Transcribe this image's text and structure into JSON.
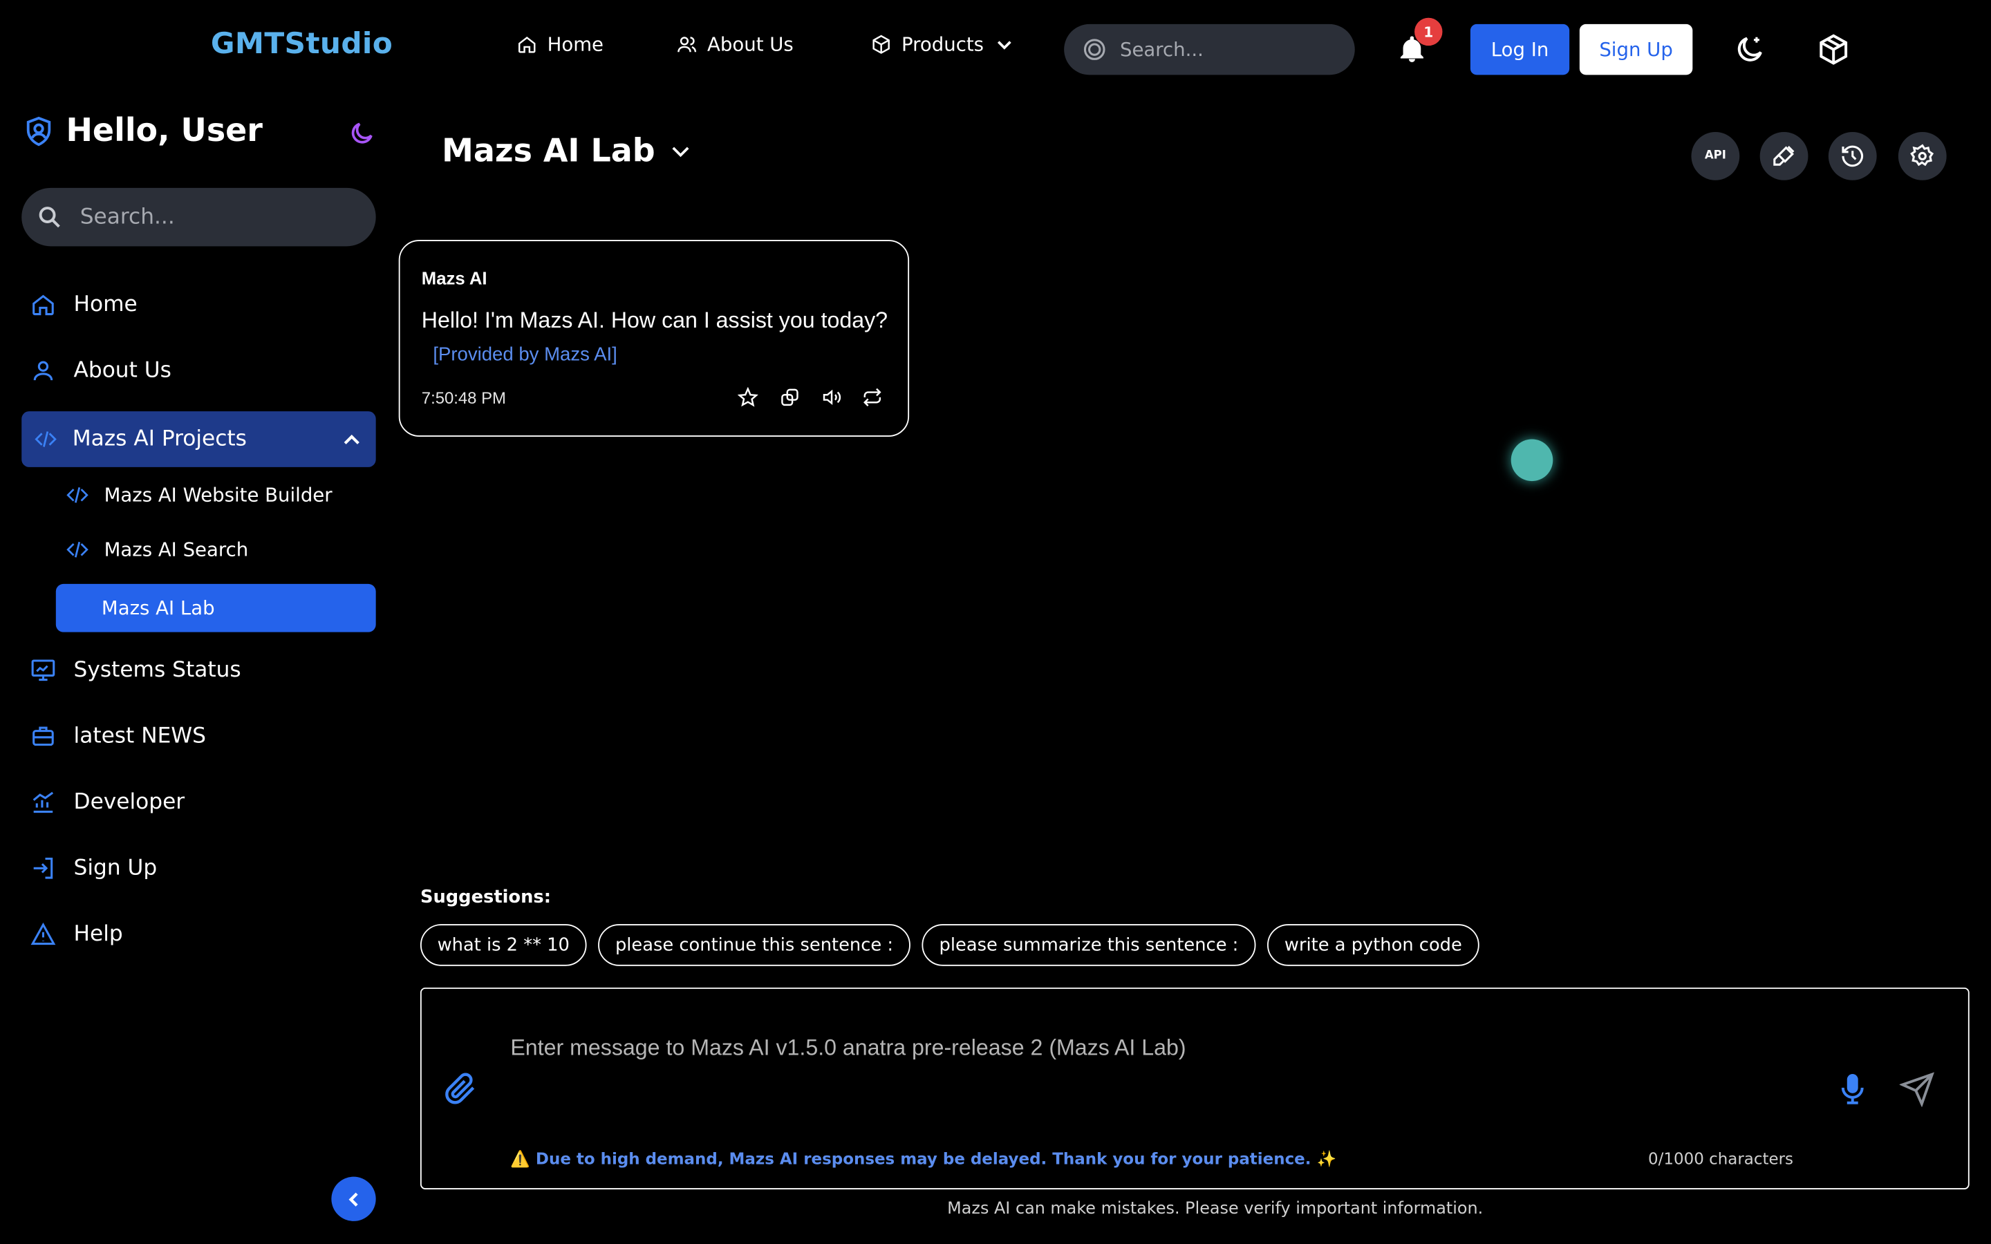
{
  "nav": {
    "logo": "GMTStudio",
    "links": [
      {
        "label": "Home",
        "icon": "home-icon"
      },
      {
        "label": "About Us",
        "icon": "users-icon"
      },
      {
        "label": "Products",
        "icon": "cube-icon"
      }
    ],
    "search_placeholder": "Search...",
    "notification_count": "1",
    "login_label": "Log In",
    "signup_label": "Sign Up"
  },
  "sidebar": {
    "greeting": "Hello, User",
    "search_placeholder": "Search...",
    "items": [
      {
        "label": "Home",
        "icon": "home-icon"
      },
      {
        "label": "About Us",
        "icon": "user-icon"
      },
      {
        "label": "Mazs AI Projects",
        "icon": "code-icon",
        "expanded": true
      },
      {
        "label": "Systems Status",
        "icon": "monitor-icon"
      },
      {
        "label": "latest NEWS",
        "icon": "briefcase-icon"
      },
      {
        "label": "Developer",
        "icon": "chart-icon"
      },
      {
        "label": "Sign Up",
        "icon": "sign-in-icon"
      },
      {
        "label": "Help",
        "icon": "warning-icon"
      }
    ],
    "projects": [
      {
        "label": "Mazs AI Website Builder"
      },
      {
        "label": "Mazs AI Search"
      },
      {
        "label": "Mazs AI Lab",
        "active": true
      }
    ]
  },
  "main": {
    "title": "Mazs AI Lab",
    "toolbar": [
      "api-icon",
      "brush-icon",
      "history-icon",
      "settings-icon"
    ],
    "api_label": "API",
    "message": {
      "author": "Mazs AI",
      "text": "Hello! I'm Mazs AI. How can I assist you today?",
      "provider": "[Provided by Mazs AI]",
      "time": "7:50:48 PM"
    },
    "suggestions_label": "Suggestions:",
    "suggestions": [
      "what is 2 ** 10",
      "please continue this sentence :",
      "please summarize this sentence :",
      "write a python code"
    ],
    "input_placeholder": "Enter message to Mazs AI v1.5.0 anatra pre-release 2 (Mazs AI Lab)",
    "warning": "⚠️ Due to high demand, Mazs AI responses may be delayed. Thank you for your patience. ✨",
    "char_count": "0/1000 characters",
    "footer": "Mazs AI can make mistakes. Please verify important information."
  },
  "colors": {
    "accent": "#2563eb",
    "logo": "#5ab1ec",
    "project_bg": "#1e3a8a",
    "badge": "#e53e3e"
  }
}
